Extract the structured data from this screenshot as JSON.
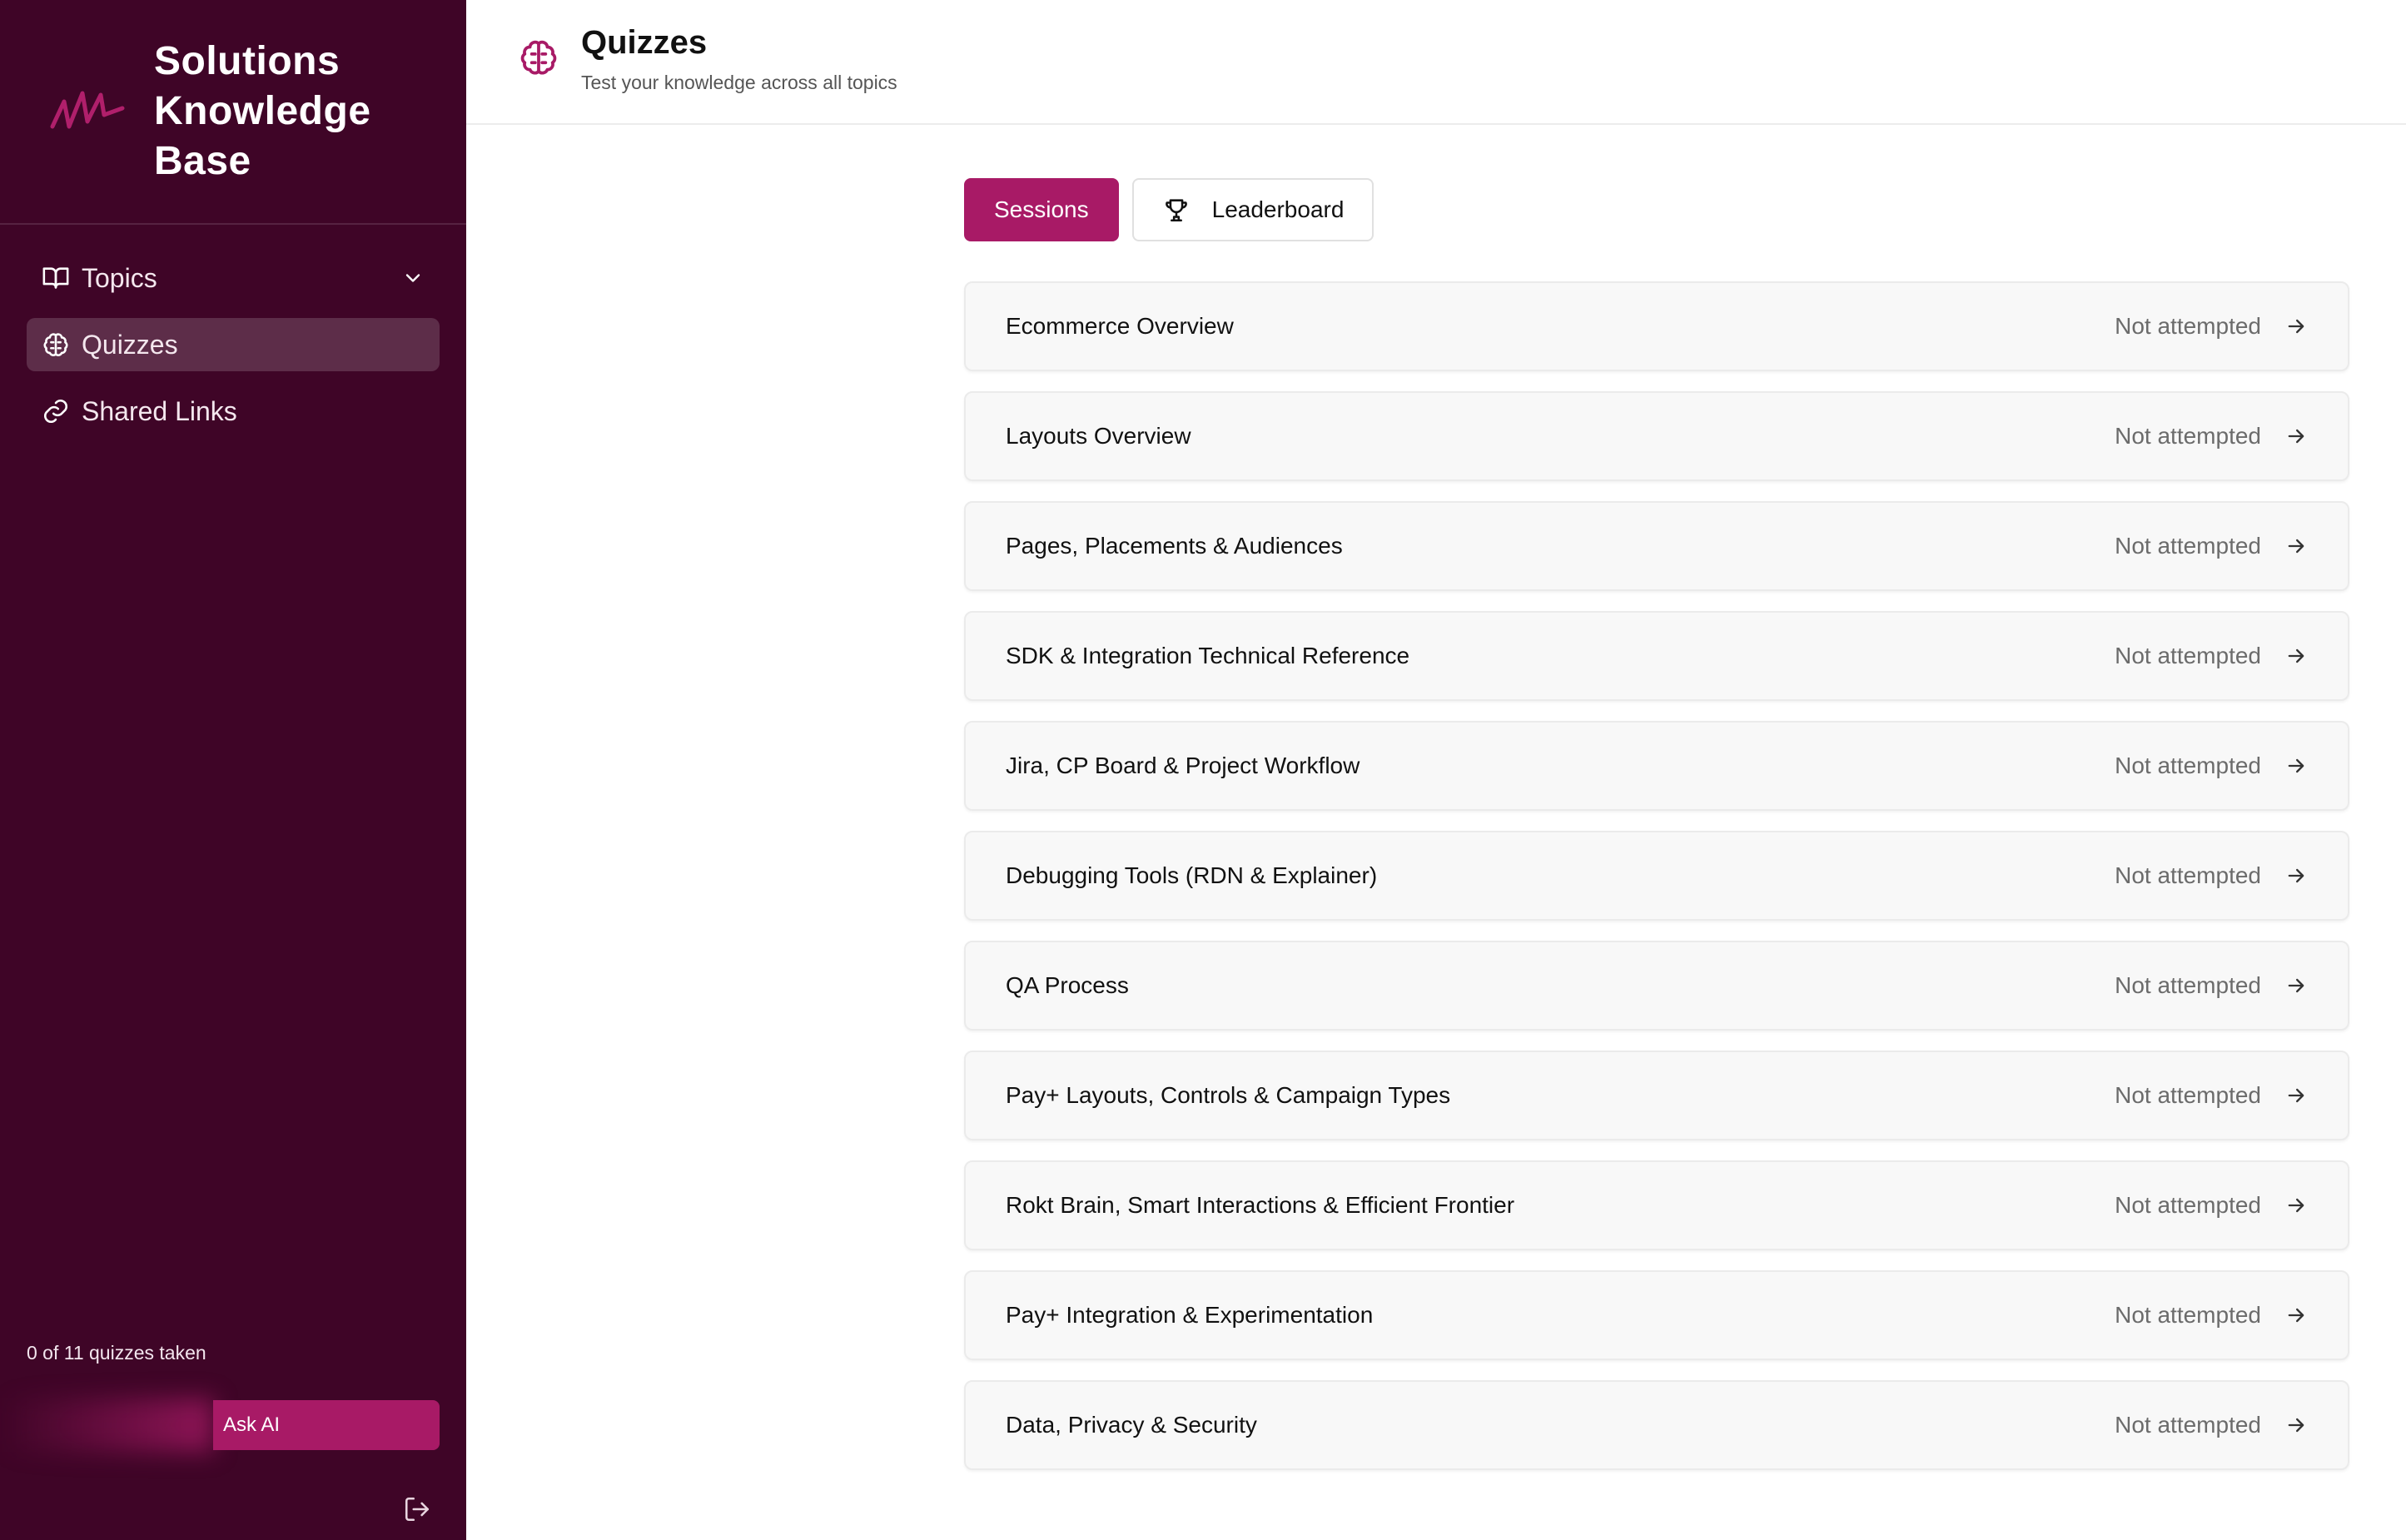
{
  "brand": {
    "logo": "zigzag-logo-icon",
    "title": "Solutions Knowledge Base"
  },
  "nav": {
    "items": [
      {
        "label": "Topics",
        "icon": "book-open-icon",
        "active": false,
        "has_chevron": true
      },
      {
        "label": "Quizzes",
        "icon": "brain-icon",
        "active": true
      },
      {
        "label": "Shared Links",
        "icon": "link-icon",
        "active": false
      }
    ]
  },
  "sidebar_footer": {
    "progress_text": "0 of 11 quizzes taken",
    "ask_ai_label": "Ask AI",
    "logout_icon": "logout-icon"
  },
  "header": {
    "icon": "brain-icon",
    "title": "Quizzes",
    "subtitle": "Test your knowledge across all topics"
  },
  "tabs": [
    {
      "label": "Sessions",
      "active": true
    },
    {
      "label": "Leaderboard",
      "active": false,
      "icon": "trophy-icon"
    }
  ],
  "quizzes": [
    {
      "name": "Ecommerce Overview",
      "status": "Not attempted"
    },
    {
      "name": "Layouts Overview",
      "status": "Not attempted"
    },
    {
      "name": "Pages, Placements & Audiences",
      "status": "Not attempted"
    },
    {
      "name": "SDK & Integration Technical Reference",
      "status": "Not attempted"
    },
    {
      "name": "Jira, CP Board & Project Workflow",
      "status": "Not attempted"
    },
    {
      "name": "Debugging Tools (RDN & Explainer)",
      "status": "Not attempted"
    },
    {
      "name": "QA Process",
      "status": "Not attempted"
    },
    {
      "name": "Pay+ Layouts, Controls & Campaign Types",
      "status": "Not attempted"
    },
    {
      "name": "Rokt Brain, Smart Interactions & Efficient Frontier",
      "status": "Not attempted"
    },
    {
      "name": "Pay+ Integration & Experimentation",
      "status": "Not attempted"
    },
    {
      "name": "Data, Privacy & Security",
      "status": "Not attempted"
    }
  ],
  "colors": {
    "sidebar": "#3f0527",
    "accent": "#a81a66"
  }
}
